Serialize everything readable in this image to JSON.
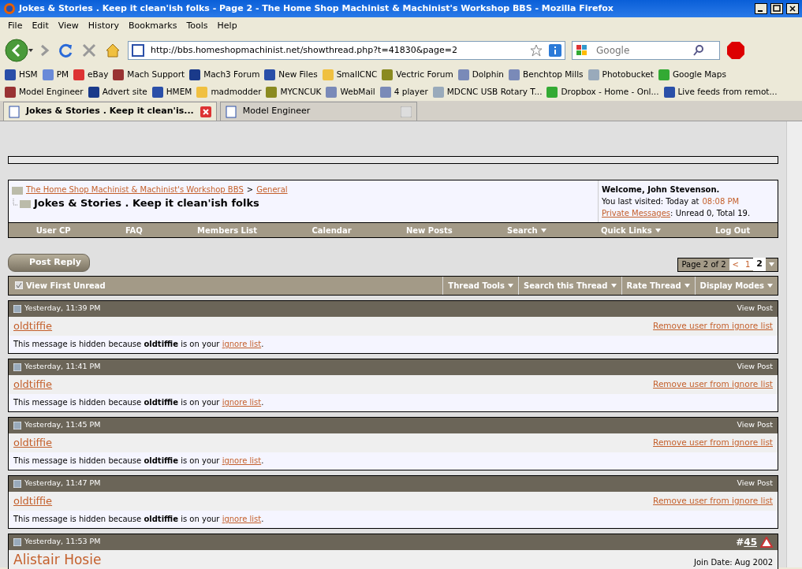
{
  "window": {
    "title": "Jokes & Stories . Keep it clean'ish folks - Page 2 - The Home Shop Machinist & Machinist's Workshop BBS - Mozilla Firefox"
  },
  "menu": [
    "File",
    "Edit",
    "View",
    "History",
    "Bookmarks",
    "Tools",
    "Help"
  ],
  "address": {
    "value": "http://bbs.homeshopmachinist.net/showthread.php?t=41830&page=2"
  },
  "search": {
    "placeholder": "Google"
  },
  "bookmarks_row_1": [
    "HSM",
    "PM",
    "eBay",
    "Mach Support",
    "Mach3 Forum",
    "New Files",
    "SmallCNC",
    "Vectric Forum",
    "Dolphin",
    "Benchtop Mills",
    "Photobucket",
    "Google Maps"
  ],
  "bookmarks_row_2": [
    "Model Engineer",
    "Advert site",
    "HMEM",
    "madmodder",
    "MYCNCUK",
    "WebMail",
    "4 player",
    "MDCNC USB Rotary T...",
    "Dropbox - Home - Onl...",
    "Live feeds from remot..."
  ],
  "tabs": [
    {
      "label": "Jokes & Stories . Keep it clean'is...",
      "selected": true
    },
    {
      "label": "Model Engineer",
      "selected": false
    }
  ],
  "breadcrumb": {
    "separator": ">",
    "links": [
      "The Home Shop Machinist & Machinist's Workshop BBS",
      "General"
    ],
    "title": "Jokes & Stories . Keep it clean'ish folks"
  },
  "welcome": {
    "greeting": "Welcome, John Stevenson.",
    "visited": "You last visited: Today at",
    "time": "08:08 PM",
    "pm_link": "Private Messages",
    "pm_text": ": Unread 0, Total 19."
  },
  "navbar": [
    {
      "label": "User CP",
      "dropdown": false
    },
    {
      "label": "FAQ",
      "dropdown": false
    },
    {
      "label": "Members List",
      "dropdown": false
    },
    {
      "label": "Calendar",
      "dropdown": false
    },
    {
      "label": "New Posts",
      "dropdown": false
    },
    {
      "label": "Search",
      "dropdown": true
    },
    {
      "label": "Quick Links",
      "dropdown": true
    },
    {
      "label": "Log Out",
      "dropdown": false
    }
  ],
  "post_reply": "Post Reply",
  "pagenav": {
    "label": "Page 2 of 2",
    "prev": "<",
    "pages": [
      {
        "label": "1",
        "selected": false
      },
      {
        "label": "2",
        "selected": true
      }
    ]
  },
  "thread_bar": {
    "first_unread": "View First Unread",
    "tools": [
      "Thread Tools",
      "Search this Thread",
      "Rate Thread",
      "Display Modes"
    ]
  },
  "posts": [
    {
      "kind": "hidden",
      "date": "Yesterday, 11:39 PM",
      "view": "View Post",
      "user": "oldtiffie",
      "remove": "Remove user from ignore list",
      "message": "This message is hidden because **oldtiffie** is on your",
      "link": "ignore list",
      "after": "."
    },
    {
      "kind": "hidden",
      "date": "Yesterday, 11:41 PM",
      "view": "View Post",
      "user": "oldtiffie",
      "remove": "Remove user from ignore list",
      "message": "This message is hidden because **oldtiffie** is on your",
      "link": "ignore list",
      "after": "."
    },
    {
      "kind": "hidden",
      "date": "Yesterday, 11:45 PM",
      "view": "View Post",
      "user": "oldtiffie",
      "remove": "Remove user from ignore list",
      "message": "This message is hidden because **oldtiffie** is on your",
      "link": "ignore list",
      "after": "."
    },
    {
      "kind": "hidden",
      "date": "Yesterday, 11:47 PM",
      "view": "View Post",
      "user": "oldtiffie",
      "remove": "Remove user from ignore list",
      "message": "This message is hidden because **oldtiffie** is on your",
      "link": "ignore list",
      "after": "."
    },
    {
      "kind": "full",
      "date": "Yesterday, 11:53 PM",
      "hash": "#",
      "number": "45",
      "user": "Alistair Hosie",
      "join": "Join Date: Aug 2002"
    }
  ]
}
